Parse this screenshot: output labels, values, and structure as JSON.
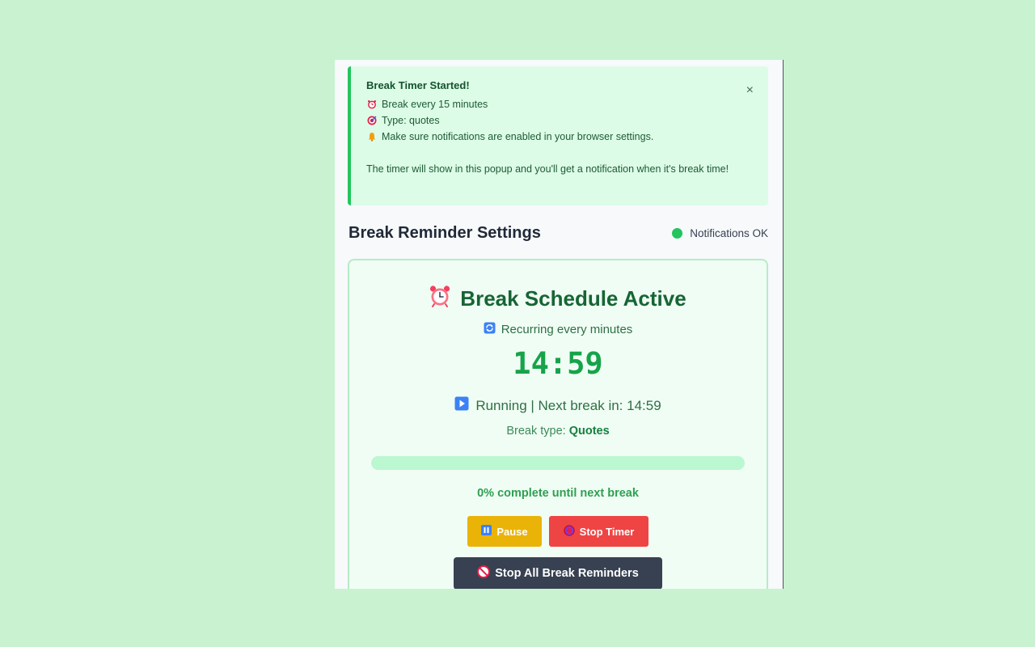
{
  "alert": {
    "title": "Break Timer Started!",
    "lines": [
      {
        "icon": "alarm-clock-icon",
        "text": "Break every 15 minutes"
      },
      {
        "icon": "target-icon",
        "text": "Type: quotes"
      },
      {
        "icon": "bell-icon",
        "text": "Make sure notifications are enabled in your browser settings."
      }
    ],
    "note": "The timer will show in this popup and you'll get a notification when it's break time!",
    "close_label": "×"
  },
  "header": {
    "title": "Break Reminder Settings",
    "notification_status": "Notifications OK",
    "status_color": "#22c55e"
  },
  "schedule": {
    "title": "Break Schedule Active",
    "recurring_text": "Recurring every minutes",
    "countdown": "14:59",
    "running_text": "Running | Next break in: 14:59",
    "break_type_label": "Break type:",
    "break_type_value": "Quotes",
    "progress_fraction": 0,
    "progress_text": "0% complete until next break"
  },
  "buttons": {
    "pause": "Pause",
    "stop_timer": "Stop Timer",
    "stop_all": "Stop All Break Reminders"
  },
  "colors": {
    "background": "#c9f2d0",
    "accent_green": "#22c55e",
    "pause": "#eab308",
    "stop": "#ef4444",
    "stop_all": "#374151"
  }
}
